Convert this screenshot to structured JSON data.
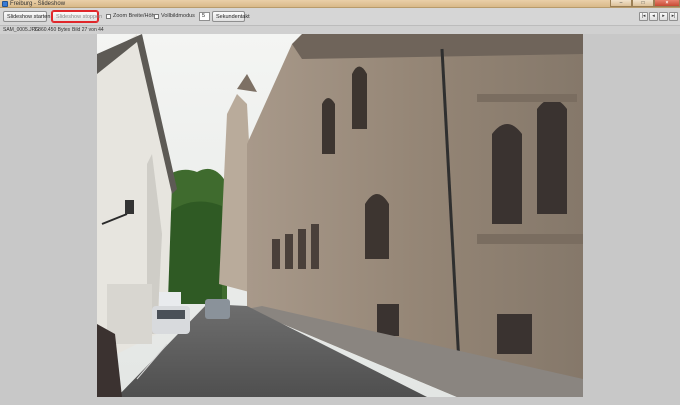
{
  "window": {
    "title": "Freiburg - Slideshow"
  },
  "toolbar": {
    "start_label": "Slideshow starten",
    "stop_label": "Slideshow stoppen",
    "zoom_label": "Zoom Breite/Höhe",
    "fullscreen_label": "Vollbildmodus",
    "seconds_value": "5",
    "seconds_label": "Sekundentakt"
  },
  "info": {
    "file": "SAM_0005.JPG",
    "size": "2.860.450 Bytes",
    "index": "Bild 27 von 44"
  },
  "colors": {
    "highlight": "#e0262a",
    "titlebar": "#d9b98a"
  },
  "icons": {
    "first": "skip-first-icon",
    "prev": "previous-icon",
    "next": "next-icon",
    "last": "skip-last-icon"
  }
}
